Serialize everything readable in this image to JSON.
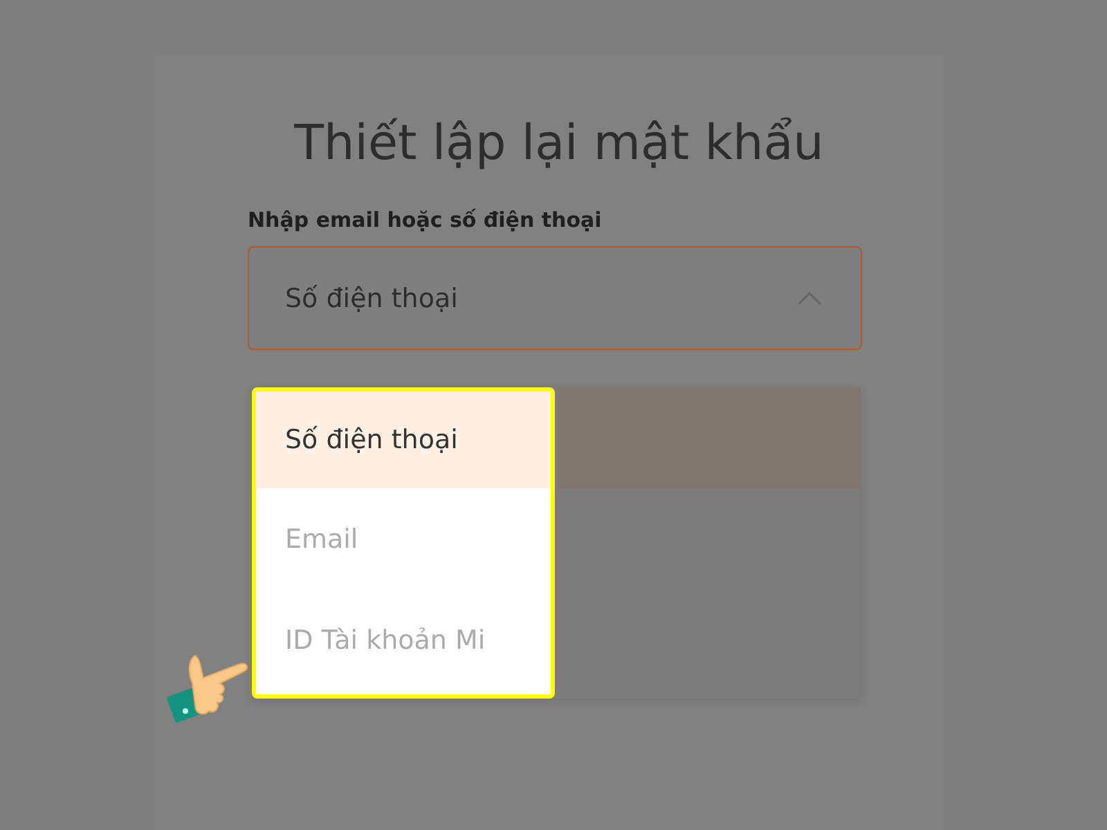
{
  "title": "Thiết lập lại mật khẩu",
  "field_label": "Nhập email hoặc số điện thoại",
  "select": {
    "value": "Số điện thoại",
    "expanded": true
  },
  "options": [
    {
      "label": "Số điện thoại",
      "selected": true
    },
    {
      "label": "Email",
      "selected": false
    },
    {
      "label": "ID Tài khoản Mi",
      "selected": false
    }
  ]
}
